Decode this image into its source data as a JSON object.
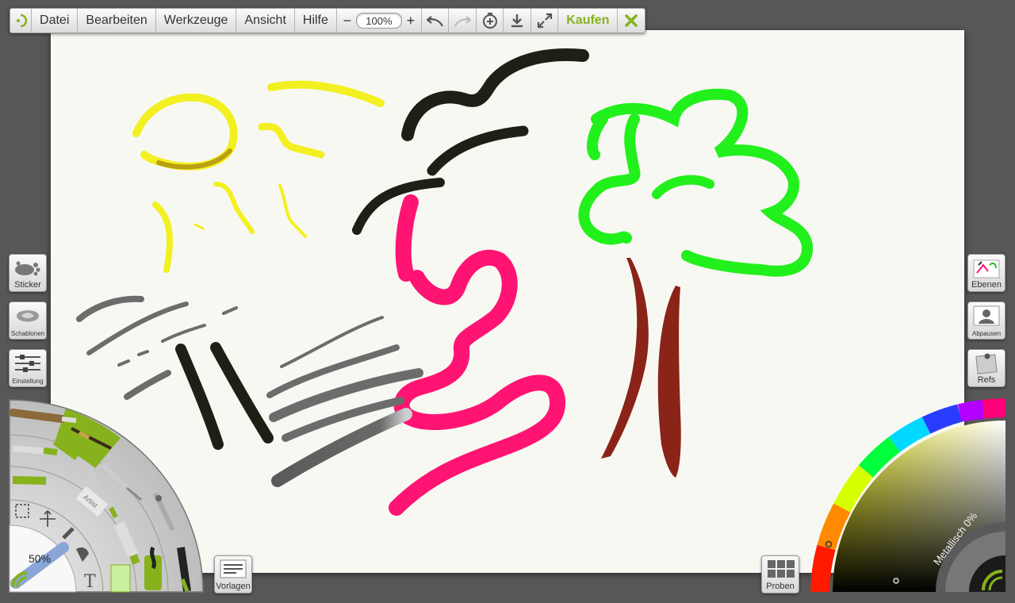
{
  "menu": {
    "items": [
      "Datei",
      "Bearbeiten",
      "Werkzeuge",
      "Ansicht",
      "Hilfe"
    ],
    "zoom_value": "100%",
    "kaufen_label": "Kaufen"
  },
  "left_panel": {
    "sticker_label": "Sticker",
    "schablonen_label": "Schablonen",
    "einstellung_label": "Einstellung"
  },
  "right_panel": {
    "ebenen_label": "Ebenen",
    "abpausen_label": "Abpausen",
    "refs_label": "Refs"
  },
  "tool_wheel": {
    "brush_size": "50%",
    "text_tool_glyph": "T"
  },
  "bottom": {
    "vorlagen_label": "Vorlagen",
    "proben_label": "Proben"
  },
  "color_picker": {
    "metallisch_label": "Metallisch 0%"
  },
  "colors": {
    "accent": "#86b21c",
    "stroke_yellow": "#f2f020",
    "stroke_black": "#1f1f16",
    "stroke_pink": "#ff1473",
    "stroke_green": "#22f01c",
    "stroke_brown": "#8a2418",
    "stroke_gray": "#6c6c6c"
  }
}
